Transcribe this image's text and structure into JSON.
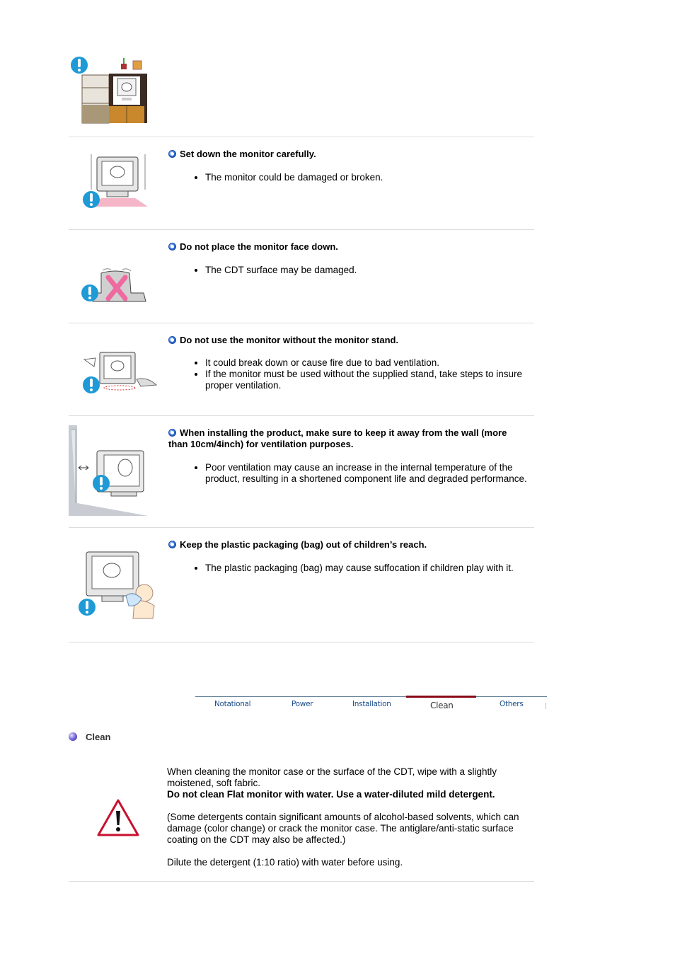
{
  "sections": [
    {
      "image": "bookshelf-monitor-illustration",
      "title": "",
      "items": []
    },
    {
      "image": "monitor-set-down-illustration",
      "title": "Set down the monitor carefully.",
      "items": [
        "The monitor could be damaged or broken."
      ]
    },
    {
      "image": "monitor-face-down-illustration",
      "title": "Do not place the monitor face down.",
      "items": [
        "The CDT surface may be damaged."
      ]
    },
    {
      "image": "monitor-without-stand-illustration",
      "title": "Do not use the monitor without the monitor stand.",
      "items": [
        "It could break down or cause fire due to bad ventilation.",
        "If the monitor must be used without the supplied stand, take steps to insure proper ventilation."
      ]
    },
    {
      "image": "monitor-wall-distance-illustration",
      "title": "When installing the product, make sure to keep it away from the wall (more than 10cm/4inch) for ventilation purposes.",
      "items": [
        "Poor ventilation may cause an increase in the internal temperature of the product, resulting in a shortened component life and degraded performance."
      ]
    },
    {
      "image": "plastic-bag-child-illustration",
      "title": "Keep the plastic packaging (bag) out of children’s reach.",
      "items": [
        "The plastic packaging (bag) may cause suffocation if children play with it."
      ]
    }
  ],
  "tabs": [
    {
      "label": "Notational",
      "active": false
    },
    {
      "label": "Power",
      "active": false
    },
    {
      "label": "Installation",
      "active": false
    },
    {
      "label": "Clean",
      "active": true
    },
    {
      "label": "Others",
      "active": false
    }
  ],
  "clean": {
    "heading": "Clean",
    "para1": "When cleaning the monitor case or the surface of the CDT, wipe with a slightly moistened, soft fabric.",
    "para1_bold": "Do not clean Flat monitor with water. Use a water-diluted mild detergent.",
    "para2": "(Some detergents contain significant amounts of alcohol-based solvents, which can damage (color change) or crack the monitor case. The antiglare/anti-static surface coating on the CDT may also be affected.)",
    "para3": "Dilute the detergent (1:10 ratio) with water before using."
  },
  "colors": {
    "warning_blue": "#1e9ad6",
    "tab_active_bar": "#8a0a18",
    "tab_text": "#1a4c8a",
    "caution_red": "#c8102e"
  }
}
